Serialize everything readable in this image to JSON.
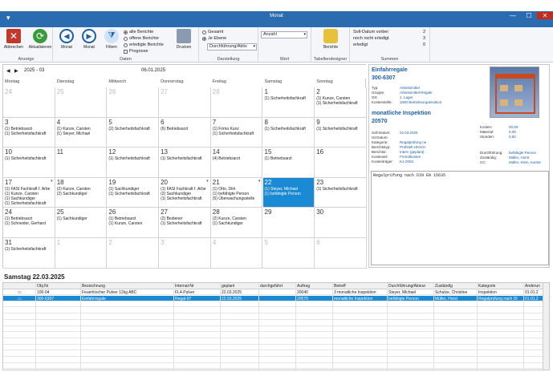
{
  "window": {
    "title": "Monat",
    "close": "✕",
    "max": "☐",
    "min": "—"
  },
  "ribbon": {
    "abbrechen": "Abbrechen",
    "aktualisieren": "Aktualisieren",
    "group_anzeige": "Anzeige",
    "prev": "Monat",
    "next": "Monat",
    "filtern": "Filtern",
    "opt_alle": "alle Berichte",
    "opt_offene": "offene Berichte",
    "opt_erledigt": "erledigte Berichte",
    "opt_prognose": "Prognose",
    "drucken": "Drucken",
    "group_daten": "Daten",
    "rad_gesamt": "Gesamt",
    "rad_je": "Je Ebene",
    "combo_darst": "Durchführung/Aktiv",
    "group_darst": "Darstellung",
    "combo_wert": "Anzahl",
    "group_wert": "Wert",
    "berichte": "Berichte",
    "group_tab": "Tabellendesigner",
    "sum1_label": "Soll-Datum vorbei",
    "sum1_val": "2",
    "sum2_label": "noch nicht erledigt",
    "sum2_val": "3",
    "sum3_label": "erledigt",
    "sum3_val": "0",
    "group_summen": "Summen"
  },
  "calendar": {
    "nav_prev": "◀",
    "nav_next": "▶",
    "month": "2025 - 03",
    "date": "06.01.2025",
    "days": [
      "Montag",
      "Dienstag",
      "Mittwoch",
      "Donnerstag",
      "Freitag",
      "Samstag",
      "Sonntag"
    ],
    "weeks": [
      [
        {
          "n": "24",
          "g": true,
          "e": []
        },
        {
          "n": "25",
          "g": true,
          "e": []
        },
        {
          "n": "26",
          "g": true,
          "e": []
        },
        {
          "n": "27",
          "g": true,
          "e": []
        },
        {
          "n": "28",
          "g": true,
          "e": []
        },
        {
          "n": "1",
          "e": [
            "(1) Sicherheitsfachkraft"
          ]
        },
        {
          "n": "2",
          "e": [
            "(1) Kunze, Carsten",
            "(1) Sicherheitsfachkraft"
          ]
        }
      ],
      [
        {
          "n": "3",
          "e": [
            "(1) Betriebsarzt",
            "(1) Sicherheitsfachkraft"
          ]
        },
        {
          "n": "4",
          "e": [
            "(1) Kunze, Carsten",
            "(1) Steyer, Michael"
          ]
        },
        {
          "n": "5",
          "e": [
            "(2) Sicherheitsfachkraft"
          ]
        },
        {
          "n": "6",
          "e": [
            "(6) Betriebsarzt"
          ]
        },
        {
          "n": "7",
          "e": [
            "(1) Firma Kunz",
            "(1) Sicherheitsfachkraft"
          ]
        },
        {
          "n": "8",
          "e": [
            "(1) Sicherheitsfachkraft"
          ]
        },
        {
          "n": "9",
          "e": [
            "(1) Sicherheitsfachkraft"
          ]
        }
      ],
      [
        {
          "n": "10",
          "e": [
            "(1) Sicherheitsfachkraft"
          ]
        },
        {
          "n": "11",
          "e": []
        },
        {
          "n": "12",
          "e": [
            "(1) Sicherheitsfachkraft"
          ]
        },
        {
          "n": "13",
          "e": [
            "(1) Sicherheitsfachkraft"
          ]
        },
        {
          "n": "14",
          "e": [
            "(4) Betriebsarzt"
          ]
        },
        {
          "n": "15",
          "e": [
            "(1) Betriebsarzt"
          ]
        },
        {
          "n": "16",
          "e": []
        }
      ],
      [
        {
          "n": "17",
          "e": [
            "(1) FASI Fachkraft f. Arbe",
            "(1) Kunze, Carsten",
            "(1) Sachkundiger",
            "(1) Sicherheitsfachkraft"
          ],
          "a": true
        },
        {
          "n": "18",
          "e": [
            "(2) Kunze, Carsten",
            "(2) Sachkundiger"
          ]
        },
        {
          "n": "19",
          "e": [
            "(1) Sachkundiger",
            "(1) Sicherheitsfachkraft"
          ]
        },
        {
          "n": "20",
          "e": [
            "(1) FASI Fachkraft f. Arbe",
            "(2) Sachkundiger",
            "(1) Sicherheitsfachkraft"
          ],
          "a": true
        },
        {
          "n": "21",
          "e": [
            "(1) Otto, Dirk",
            "(1) befähigte Person",
            "(5) Überwachungsstelle"
          ],
          "a": true
        },
        {
          "n": "22",
          "e": [
            "(1) Steyer, Michael",
            "(1) befähigte Person"
          ],
          "sel": true
        },
        {
          "n": "23",
          "e": [
            "(1) Sicherheitsfachkraft"
          ]
        }
      ],
      [
        {
          "n": "24",
          "e": [
            "(1) Betriebsarzt",
            "(1) Schneider, Gerhard"
          ]
        },
        {
          "n": "25",
          "e": [
            "(1) Sachkundiger"
          ]
        },
        {
          "n": "26",
          "e": [
            "(1) Betriebsarzt",
            "(1) Kunze, Carsten"
          ]
        },
        {
          "n": "27",
          "e": [
            "(2) Bediener",
            "(1) Sicherheitsfachkraft"
          ]
        },
        {
          "n": "28",
          "e": [
            "(2) Kunze, Carsten",
            "(1) Sachkundiger"
          ]
        },
        {
          "n": "29",
          "e": []
        },
        {
          "n": "30",
          "e": []
        }
      ],
      [
        {
          "n": "31",
          "e": [
            "(1) Sicherheitsfachkraft"
          ]
        },
        {
          "n": "1",
          "g": true,
          "e": []
        },
        {
          "n": "2",
          "g": true,
          "e": []
        },
        {
          "n": "3",
          "g": true,
          "e": []
        },
        {
          "n": "4",
          "g": true,
          "e": []
        },
        {
          "n": "5",
          "g": true,
          "e": []
        },
        {
          "n": "6",
          "g": true,
          "e": []
        }
      ]
    ]
  },
  "detail": {
    "title": "Einfahrregale",
    "code": "300-6307",
    "rows1": [
      [
        "Typ:",
        "Arbeitsmittel"
      ],
      [
        "Gruppe:",
        "Arbeitsmittel-Regale"
      ],
      [
        "Ort:",
        "1. Lager"
      ],
      [
        "Kostenstelle:",
        "1000 Betriebsorganisation"
      ]
    ],
    "insp": "monatliche Inspektion",
    "num": "20570",
    "rows2": [
      [
        "Soll-Datum:",
        "22.03.2025"
      ],
      [
        "Ist-Datum:",
        ""
      ],
      [
        "Kategorie:",
        "Regalprüfung ne"
      ],
      [
        "Berichtstyp:",
        "Prüfstell-HIOCH"
      ],
      [
        "Berichtsr:",
        "Intern (geplant)"
      ],
      [
        "Kostenart:",
        "Fremdkosten"
      ],
      [
        "Kostenträger:",
        "K1-2003"
      ]
    ],
    "costs": [
      [
        "Kosten:",
        "00,00"
      ],
      [
        "Material:",
        "0,00"
      ],
      [
        "Stunden:",
        "0,50"
      ]
    ],
    "resp": [
      [
        "Durchführung:",
        "befähigte Person"
      ],
      [
        "Zuständig:",
        "Müller, Horst"
      ],
      [
        "CC:",
        "Müller, Klein, Karste"
      ]
    ],
    "memo": "Regalprüfung nach DIN EN 15635"
  },
  "bottom": {
    "title": "Samstag 22.03.2025",
    "headers": [
      "Obj.Nr",
      "Bezeichnung",
      "Internal-Nr",
      "geplant",
      "durchgeführt",
      "Auftrag",
      "Betreff",
      "Durchführung/Akteur",
      "Zuständig",
      "Kategorie",
      "Anderun"
    ],
    "rows": [
      [
        "100-04",
        "Feuerlöscher Pulver 12kg ABC",
        "FL4-Pulver",
        "22.03.2025",
        "",
        "20040",
        "3 monatliche Inspektion",
        "Steyer, Michael",
        "Schulze, Christine",
        "Inspektion",
        "01.01.2"
      ],
      [
        "300-6307",
        "Einfahrregale",
        "Regal-07",
        "22.03.2025",
        "",
        "20570",
        "monatliche Inspektion",
        "befähigte Person",
        "Müller, Horst",
        "Regalprüfung nach DI",
        "01.01.2"
      ]
    ]
  }
}
